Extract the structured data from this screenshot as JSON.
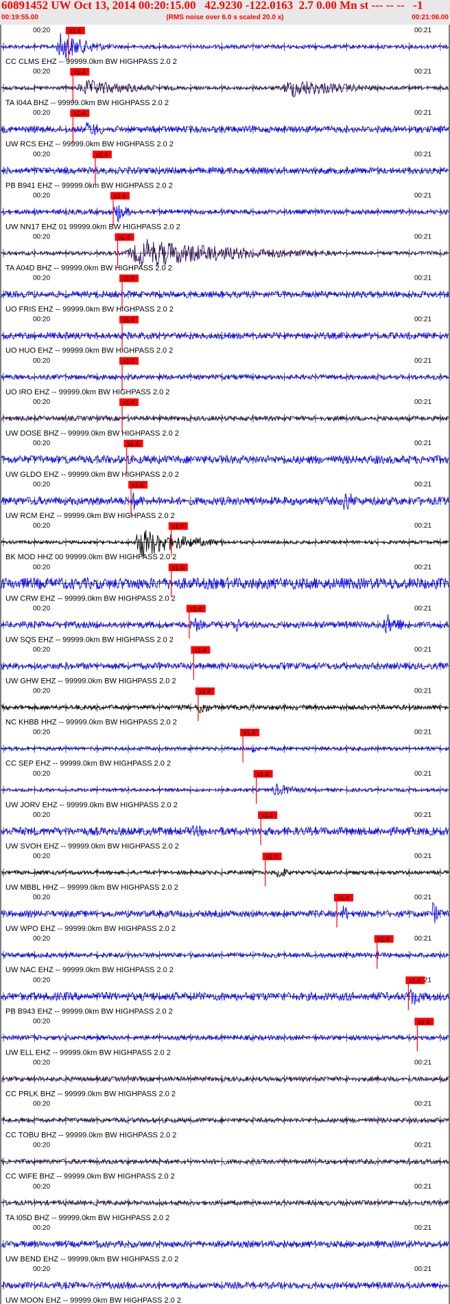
{
  "header": {
    "title": "60891452 UW Oct 13, 2014 00:20:15.00   42.9230 -122.0163  2.7 0.00 Mn st --- -- --   -1",
    "start_time": "00:19:55.00",
    "end_time": "00:21:06.00",
    "rms_note": "(RMS noise over 6.0 s scaled 20.0 x)"
  },
  "tick_labels": {
    "left": "00:20",
    "right": "00:21"
  },
  "pick_label": "x1.4",
  "colors": {
    "blue": "#0000ff",
    "dark": "#2a0a55",
    "black": "#000000",
    "pick": "#ff0000",
    "axis": "#000000"
  },
  "traces": [
    {
      "label": "CC CLMS EHZ -- 99999.0km BW  HIGHPASS  2.0  2",
      "color": "blue",
      "pick": 0.15,
      "base": 0.12,
      "bursts": [
        [
          0.12,
          0.25,
          0.9
        ]
      ]
    },
    {
      "label": "TA I04A BHZ -- 99999.0km BW  HIGHPASS  2.0  2",
      "color": "dark",
      "pick": 0.16,
      "base": 0.12,
      "bursts": [
        [
          0.16,
          0.45,
          0.5
        ],
        [
          0.62,
          0.9,
          0.6
        ]
      ]
    },
    {
      "label": "UW RCS EHZ -- 99999.0km BW  HIGHPASS  2.0  2",
      "color": "blue",
      "pick": 0.16,
      "base": 0.2,
      "bursts": [
        [
          0.18,
          0.3,
          0.5
        ]
      ]
    },
    {
      "label": "PB B941 EHZ -- 99999.0km BW  HIGHPASS  2.0  2",
      "color": "blue",
      "pick": 0.21,
      "base": 0.2,
      "bursts": []
    },
    {
      "label": "UW NN17 EHZ 01 99999.0km BW  HIGHPASS  2.0  2",
      "color": "blue",
      "pick": 0.25,
      "base": 0.15,
      "bursts": [
        [
          0.25,
          0.3,
          0.8
        ]
      ]
    },
    {
      "label": "TA A04D BHZ -- 99999.0km BW  HIGHPASS  2.0  2",
      "color": "dark",
      "pick": 0.26,
      "base": 0.12,
      "bursts": [
        [
          0.27,
          0.75,
          0.9
        ]
      ]
    },
    {
      "label": "UO FRIS EHZ -- 99999.0km BW  HIGHPASS  2.0  2",
      "color": "blue",
      "pick": 0.27,
      "base": 0.2,
      "bursts": []
    },
    {
      "label": "UO HUO EHZ -- 99999.0km BW  HIGHPASS  2.0  2",
      "color": "blue",
      "pick": 0.27,
      "base": 0.2,
      "bursts": []
    },
    {
      "label": "UO IRO EHZ -- 99999.0km BW  HIGHPASS  2.0  2",
      "color": "blue",
      "pick": 0.27,
      "base": 0.15,
      "bursts": []
    },
    {
      "label": "UW DOSE BHZ -- 99999.0km BW  HIGHPASS  2.0  2",
      "color": "dark",
      "pick": 0.27,
      "base": 0.15,
      "bursts": []
    },
    {
      "label": "UW GLDO EHZ -- 99999.0km BW  HIGHPASS  2.0  2",
      "color": "blue",
      "pick": 0.28,
      "base": 0.25,
      "bursts": []
    },
    {
      "label": "UW RCM EHZ -- 99999.0km BW  HIGHPASS  2.0  2",
      "color": "blue",
      "pick": 0.29,
      "base": 0.25,
      "bursts": [
        [
          0.29,
          0.35,
          0.6
        ],
        [
          0.76,
          0.82,
          0.8
        ]
      ]
    },
    {
      "label": "BK MOD HHZ 00 99999.0km BW  HIGHPASS  2.0  2",
      "color": "black",
      "pick": 0.38,
      "base": 0.1,
      "bursts": [
        [
          0.29,
          0.5,
          0.95
        ]
      ]
    },
    {
      "label": "UW CRW EHZ -- 99999.0km BW  HIGHPASS  2.0  2",
      "color": "blue",
      "pick": 0.38,
      "base": 0.35,
      "bursts": []
    },
    {
      "label": "UW SQS EHZ -- 99999.0km BW  HIGHPASS  2.0  2",
      "color": "blue",
      "pick": 0.42,
      "base": 0.2,
      "bursts": [
        [
          0.43,
          0.47,
          0.5
        ],
        [
          0.52,
          0.56,
          0.5
        ],
        [
          0.85,
          0.95,
          0.7
        ]
      ]
    },
    {
      "label": "UW GHW EHZ -- 99999.0km BW  HIGHPASS  2.0  2",
      "color": "blue",
      "pick": 0.43,
      "base": 0.2,
      "bursts": []
    },
    {
      "label": "NC KHBB HHZ -- 99999.0km BW  HIGHPASS  2.0  2",
      "color": "black",
      "pick": 0.44,
      "base": 0.15,
      "bursts": [
        [
          0.44,
          0.48,
          0.6
        ]
      ]
    },
    {
      "label": "CC SEP EHZ -- 99999.0km BW  HIGHPASS  2.0  2",
      "color": "blue",
      "pick": 0.54,
      "base": 0.12,
      "bursts": [
        [
          0.56,
          0.58,
          0.4
        ]
      ]
    },
    {
      "label": "UW JORV EHZ -- 99999.0km BW  HIGHPASS  2.0  2",
      "color": "blue",
      "pick": 0.57,
      "base": 0.1,
      "bursts": [
        [
          0.6,
          0.72,
          0.4
        ]
      ]
    },
    {
      "label": "UW SVOH EHZ -- 99999.0km BW  HIGHPASS  2.0  2",
      "color": "blue",
      "pick": 0.58,
      "base": 0.25,
      "bursts": [
        [
          0.4,
          0.7,
          0.35
        ]
      ]
    },
    {
      "label": "UW MBBL HHZ -- 99999.0km BW  HIGHPASS  2.0  2",
      "color": "black",
      "pick": 0.59,
      "base": 0.12,
      "bursts": [
        [
          0.61,
          0.66,
          0.5
        ]
      ]
    },
    {
      "label": "UW WPO EHZ -- 99999.0km BW  HIGHPASS  2.0  2",
      "color": "blue",
      "pick": 0.75,
      "base": 0.2,
      "bursts": [
        [
          0.76,
          0.8,
          0.6
        ],
        [
          0.96,
          1.0,
          0.8
        ]
      ]
    },
    {
      "label": "UW NAC EHZ -- 99999.0km BW  HIGHPASS  2.0  2",
      "color": "blue",
      "pick": 0.84,
      "base": 0.15,
      "bursts": []
    },
    {
      "label": "PB B943 EHZ -- 99999.0km BW  HIGHPASS  2.0  2",
      "color": "blue",
      "pick": 0.91,
      "base": 0.25,
      "bursts": [
        [
          0.3,
          0.6,
          0.3
        ],
        [
          0.91,
          0.97,
          0.7
        ]
      ]
    },
    {
      "label": "UW ELL EHZ -- 99999.0km BW  HIGHPASS  2.0  2",
      "color": "blue",
      "pick": 0.93,
      "base": 0.15,
      "bursts": []
    },
    {
      "label": "CC PRLK BHZ -- 99999.0km BW  HIGHPASS  2.0  2",
      "color": "dark",
      "pick": null,
      "base": 0.15,
      "bursts": []
    },
    {
      "label": "CC TOBU BHZ -- 99999.0km BW  HIGHPASS  2.0  2",
      "color": "dark",
      "pick": null,
      "base": 0.15,
      "bursts": []
    },
    {
      "label": "CC WIFE BHZ -- 99999.0km BW  HIGHPASS  2.0  2",
      "color": "dark",
      "pick": null,
      "base": 0.15,
      "bursts": []
    },
    {
      "label": "TA I05D BHZ -- 99999.0km BW  HIGHPASS  2.0  2",
      "color": "dark",
      "pick": null,
      "base": 0.15,
      "bursts": []
    },
    {
      "label": "UW BEND EHZ -- 99999.0km BW  HIGHPASS  2.0  2",
      "color": "blue",
      "pick": null,
      "base": 0.2,
      "bursts": []
    },
    {
      "label": "UW MOON EHZ -- 99999.0km BW  HIGHPASS  2.0  2",
      "color": "blue",
      "pick": null,
      "base": 0.2,
      "bursts": []
    }
  ]
}
